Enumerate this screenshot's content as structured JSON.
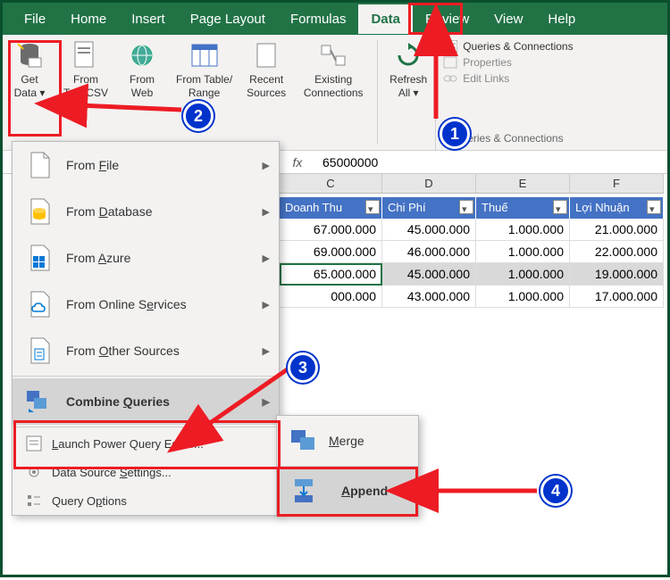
{
  "tabs": {
    "file": "File",
    "home": "Home",
    "insert": "Insert",
    "page_layout": "Page Layout",
    "formulas": "Formulas",
    "data": "Data",
    "review": "Review",
    "view": "View",
    "help": "Help"
  },
  "ribbon": {
    "get_data": "Get\nData ▾",
    "from_text": "From\nText/CSV",
    "from_web": "From\nWeb",
    "from_table": "From Table/\nRange",
    "recent": "Recent\nSources",
    "existing": "Existing\nConnections",
    "refresh": "Refresh\nAll ▾",
    "queries_conn": "Queries & Connections",
    "properties": "Properties",
    "edit_links": "Edit Links",
    "group_label": "Queries & Connections"
  },
  "formula": {
    "fx": "fx",
    "value": "65000000"
  },
  "columns": [
    "C",
    "D",
    "E",
    "F"
  ],
  "table": {
    "headers": [
      "Doanh Thu",
      "Chi Phí",
      "Thuế",
      "Lợi Nhuận"
    ],
    "rows": [
      [
        "67.000.000",
        "45.000.000",
        "1.000.000",
        "21.000.000"
      ],
      [
        "69.000.000",
        "46.000.000",
        "1.000.000",
        "22.000.000"
      ],
      [
        "65.000.000",
        "45.000.000",
        "1.000.000",
        "19.000.000"
      ],
      [
        "000.000",
        "43.000.000",
        "1.000.000",
        "17.000.000"
      ]
    ],
    "selected_row": 2
  },
  "menu": {
    "from_file": "From File",
    "from_database": "From Database",
    "from_azure": "From Azure",
    "from_online": "From Online Services",
    "from_other": "From Other Sources",
    "combine": "Combine Queries",
    "launch_pq": "Launch Power Query Editor...",
    "ds_settings": "Data Source Settings...",
    "query_opts": "Query Options"
  },
  "submenu": {
    "merge": "Merge",
    "append": "Append"
  },
  "badges": {
    "b1": "1",
    "b2": "2",
    "b3": "3",
    "b4": "4"
  }
}
